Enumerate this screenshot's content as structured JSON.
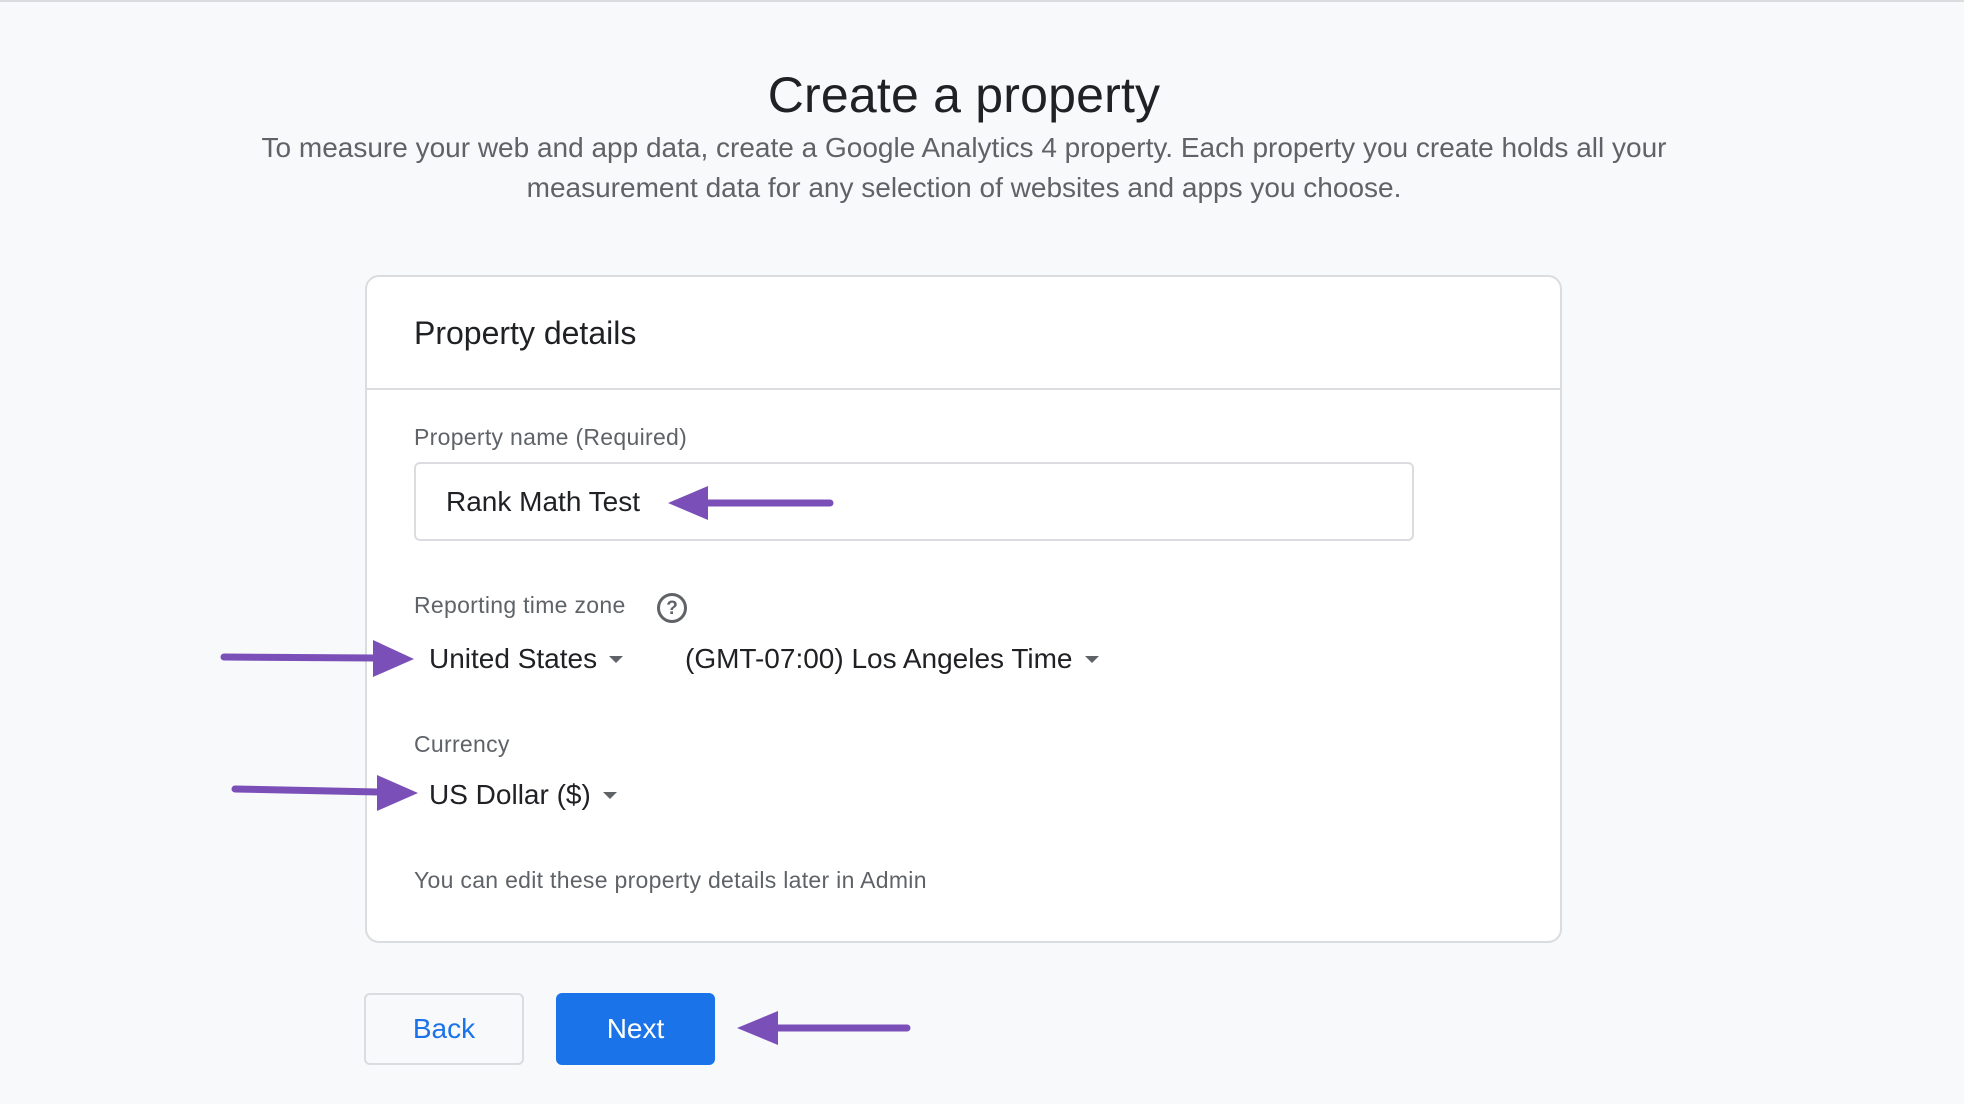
{
  "page": {
    "title": "Create a property",
    "intro": "To measure your web and app data, create a Google Analytics 4 property. Each property you create holds all your measurement data for any selection of websites and apps you choose."
  },
  "card": {
    "title": "Property details",
    "property_name": {
      "label": "Property name (Required)",
      "value": "Rank Math Test"
    },
    "time_zone": {
      "label": "Reporting time zone",
      "help_icon_glyph": "?",
      "country": "United States",
      "zone": "(GMT-07:00) Los Angeles Time"
    },
    "currency": {
      "label": "Currency",
      "value": "US Dollar ($)"
    },
    "note": "You can edit these property details later in Admin"
  },
  "buttons": {
    "back": "Back",
    "next": "Next"
  },
  "colors": {
    "accent": "#1a73e8",
    "annotation_arrow": "#7b4fb8"
  }
}
